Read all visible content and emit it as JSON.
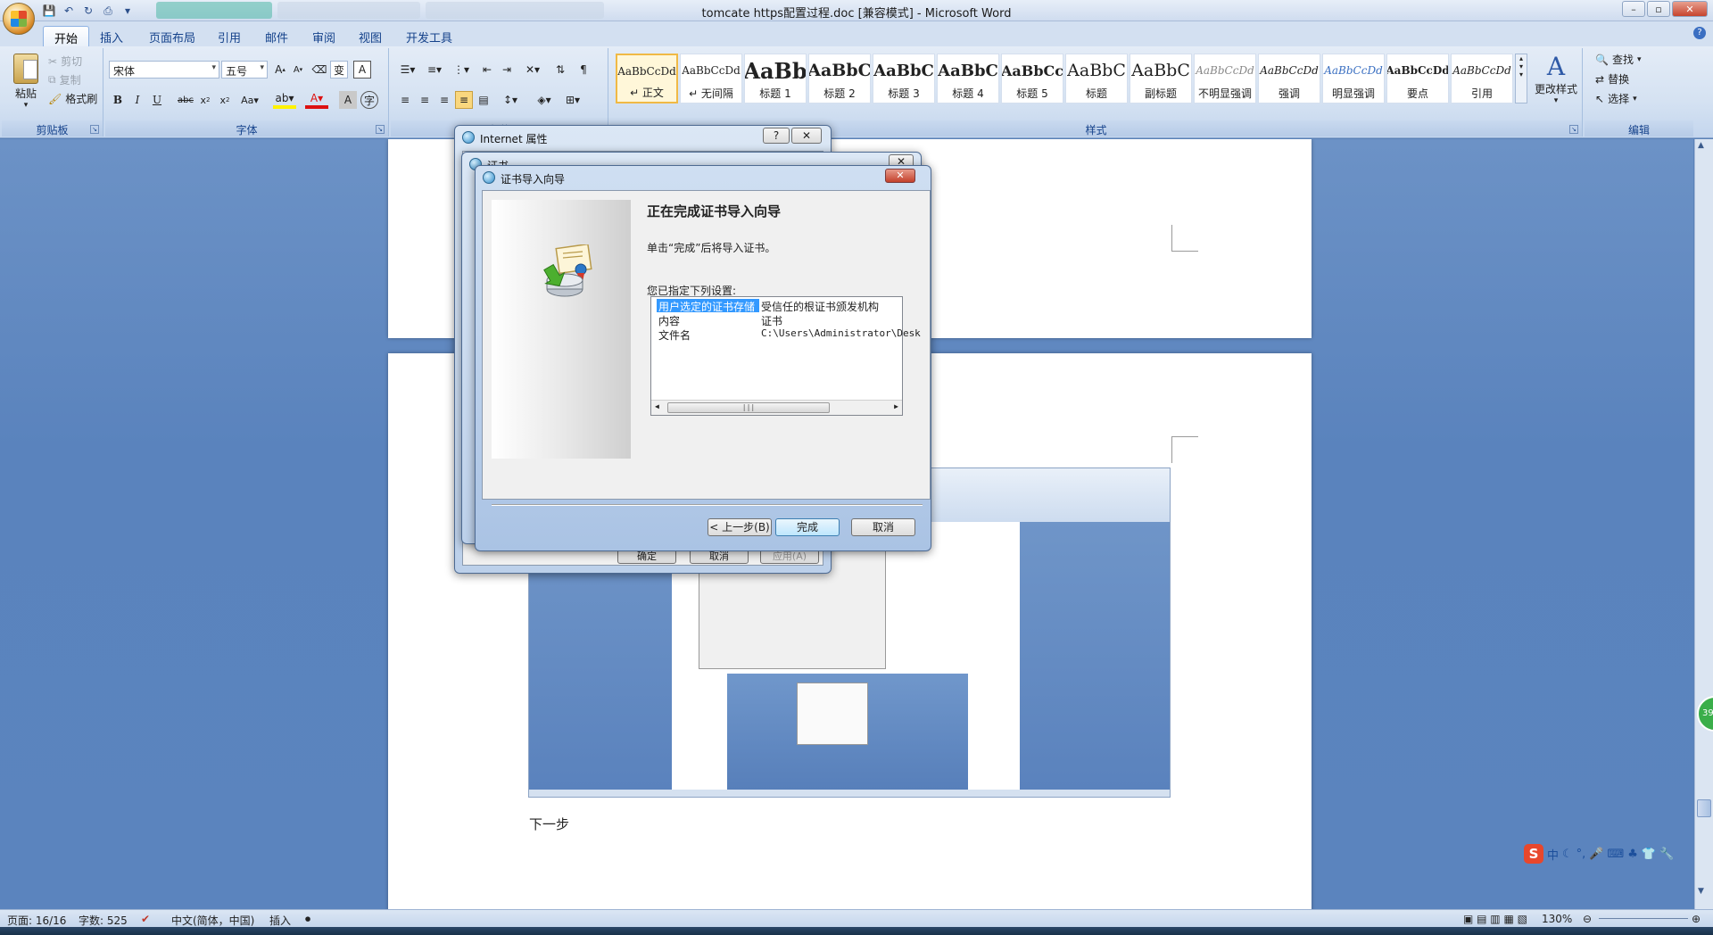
{
  "window": {
    "title": "tomcate https配置过程.doc [兼容模式] - Microsoft Word",
    "controls": [
      "–",
      "▫",
      "✕"
    ]
  },
  "quick_access": [
    "save-icon",
    "undo-icon",
    "redo-icon",
    "print-preview-icon"
  ],
  "tabs": [
    {
      "label": "开始",
      "active": true
    },
    {
      "label": "插入"
    },
    {
      "label": "页面布局"
    },
    {
      "label": "引用"
    },
    {
      "label": "邮件"
    },
    {
      "label": "审阅"
    },
    {
      "label": "视图"
    },
    {
      "label": "开发工具"
    }
  ],
  "ribbon": {
    "clipboard": {
      "label": "剪贴板",
      "paste": "粘贴",
      "cut": "剪切",
      "copy": "复制",
      "format_painter": "格式刷"
    },
    "font": {
      "label": "字体",
      "font_name": "宋体",
      "font_size": "五号"
    },
    "paragraph": {
      "label": "段落"
    },
    "styles": {
      "label": "样式",
      "items": [
        {
          "sample": "AaBbCcDd",
          "name": "↵ 正文",
          "selected": true
        },
        {
          "sample": "AaBbCcDd",
          "name": "↵ 无间隔"
        },
        {
          "sample": "AaBb",
          "name": "标题 1"
        },
        {
          "sample": "AaBbC",
          "name": "标题 2"
        },
        {
          "sample": "AaBbC",
          "name": "标题 3"
        },
        {
          "sample": "AaBbC",
          "name": "标题 4"
        },
        {
          "sample": "AaBbCc",
          "name": "标题 5"
        },
        {
          "sample": "AaBbC",
          "name": "标题"
        },
        {
          "sample": "AaBbC",
          "name": "副标题"
        },
        {
          "sample": "AaBbCcDd",
          "name": "不明显强调"
        },
        {
          "sample": "AaBbCcDd",
          "name": "强调"
        },
        {
          "sample": "AaBbCcDd",
          "name": "明显强调"
        },
        {
          "sample": "AaBbCcDd",
          "name": "要点"
        },
        {
          "sample": "AaBbCcDd",
          "name": "引用"
        }
      ],
      "change_styles": "更改样式"
    },
    "editing": {
      "label": "编辑",
      "find": "查找",
      "replace": "替换",
      "select": "选择"
    }
  },
  "document": {
    "caption_next": "下一步"
  },
  "internet_props_dialog": {
    "title": "Internet 属性",
    "help": "?",
    "close": "✕",
    "buttons": {
      "ok": "确定",
      "cancel": "取消",
      "apply": "应用(A)"
    }
  },
  "cert_dialog": {
    "title": "证书"
  },
  "wizard": {
    "title": "证书导入向导",
    "close": "✕",
    "heading": "正在完成证书导入向导",
    "instruction": "单击“完成”后将导入证书。",
    "settings_label": "您已指定下列设置:",
    "settings": [
      {
        "key": "用户选定的证书存储",
        "value": "受信任的根证书颁发机构",
        "selected": true
      },
      {
        "key": "内容",
        "value": "证书"
      },
      {
        "key": "文件名",
        "value": "C:\\Users\\Administrator\\Desk"
      }
    ],
    "buttons": {
      "back": "< 上一步(B)",
      "finish": "完成",
      "cancel": "取消"
    }
  },
  "statusbar": {
    "page": "页面: 16/16",
    "words": "字数: 525",
    "language": "中文(简体，中国)",
    "mode": "插入",
    "zoom": "130%"
  },
  "ime": {
    "logo": "S",
    "mode": "中"
  },
  "side_badge": "39"
}
